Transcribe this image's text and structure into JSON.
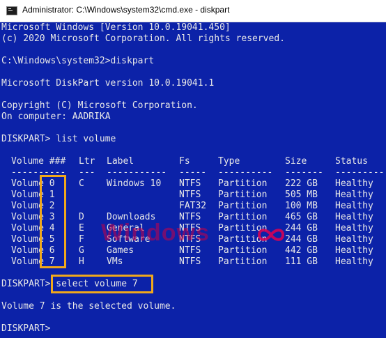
{
  "window": {
    "title": "Administrator: C:\\Windows\\system32\\cmd.exe - diskpart"
  },
  "console": {
    "intro_lines": [
      "Microsoft Windows [Version 10.0.19041.450]",
      "(c) 2020 Microsoft Corporation. All rights reserved.",
      "",
      "C:\\Windows\\system32>diskpart",
      "",
      "Microsoft DiskPart version 10.0.19041.1",
      "",
      "Copyright (C) Microsoft Corporation.",
      "On computer: AADRIKA",
      "",
      "DISKPART> list volume"
    ],
    "table": {
      "headers": [
        "Volume ###",
        "Ltr",
        "Label",
        "Fs",
        "Type",
        "Size",
        "Status"
      ],
      "dashes": [
        "----------",
        "---",
        "-----------",
        "-----",
        "----------",
        "-------",
        "---------"
      ],
      "rows": [
        {
          "volume": "Volume 0",
          "ltr": "C",
          "label": "Windows 10",
          "fs": "NTFS",
          "type": "Partition",
          "size": "222 GB",
          "status": "Healthy"
        },
        {
          "volume": "Volume 1",
          "ltr": "",
          "label": "",
          "fs": "NTFS",
          "type": "Partition",
          "size": "505 MB",
          "status": "Healthy"
        },
        {
          "volume": "Volume 2",
          "ltr": "",
          "label": "",
          "fs": "FAT32",
          "type": "Partition",
          "size": "100 MB",
          "status": "Healthy"
        },
        {
          "volume": "Volume 3",
          "ltr": "D",
          "label": "Downloads",
          "fs": "NTFS",
          "type": "Partition",
          "size": "465 GB",
          "status": "Healthy"
        },
        {
          "volume": "Volume 4",
          "ltr": "E",
          "label": "General",
          "fs": "NTFS",
          "type": "Partition",
          "size": "244 GB",
          "status": "Healthy"
        },
        {
          "volume": "Volume 5",
          "ltr": "F",
          "label": "Software",
          "fs": "NTFS",
          "type": "Partition",
          "size": "244 GB",
          "status": "Healthy"
        },
        {
          "volume": "Volume 6",
          "ltr": "G",
          "label": "Games",
          "fs": "NTFS",
          "type": "Partition",
          "size": "442 GB",
          "status": "Healthy"
        },
        {
          "volume": "Volume 7",
          "ltr": "H",
          "label": "VMs",
          "fs": "NTFS",
          "type": "Partition",
          "size": "111 GB",
          "status": "Healthy"
        }
      ]
    },
    "prompt": "DISKPART> ",
    "command": "select volume 7",
    "result": "Volume 7 is the selected volume.",
    "final_prompt": "DISKPART> "
  },
  "watermark": {
    "text": "Windows"
  },
  "colors": {
    "console_bg": "#0c22a8",
    "console_text": "#e8e8e8",
    "highlight": "#f0a81c"
  }
}
